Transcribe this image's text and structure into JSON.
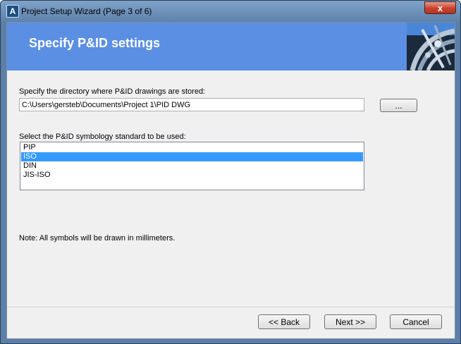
{
  "window": {
    "title": "Project Setup Wizard (Page 3 of 6)",
    "close_glyph": "x",
    "app_icon_glyph": "A"
  },
  "banner": {
    "title": "Specify P&ID settings"
  },
  "directory": {
    "label": "Specify the directory where P&ID drawings are stored:",
    "value": "C:\\Users\\gersteb\\Documents\\Project 1\\PID DWG",
    "browse_label": "..."
  },
  "symbology": {
    "label": "Select the P&ID symbology standard to be used:",
    "options": [
      "PIP",
      "ISO",
      "DIN",
      "JIS-ISO"
    ],
    "selected": "ISO"
  },
  "note": "Note: All symbols will be drawn in millimeters.",
  "footer": {
    "back_label": "<< Back",
    "next_label": "Next >>",
    "cancel_label": "Cancel"
  },
  "colors": {
    "banner": "#5b8fe3",
    "selection": "#3399ff",
    "close_button": "#c7422d"
  }
}
